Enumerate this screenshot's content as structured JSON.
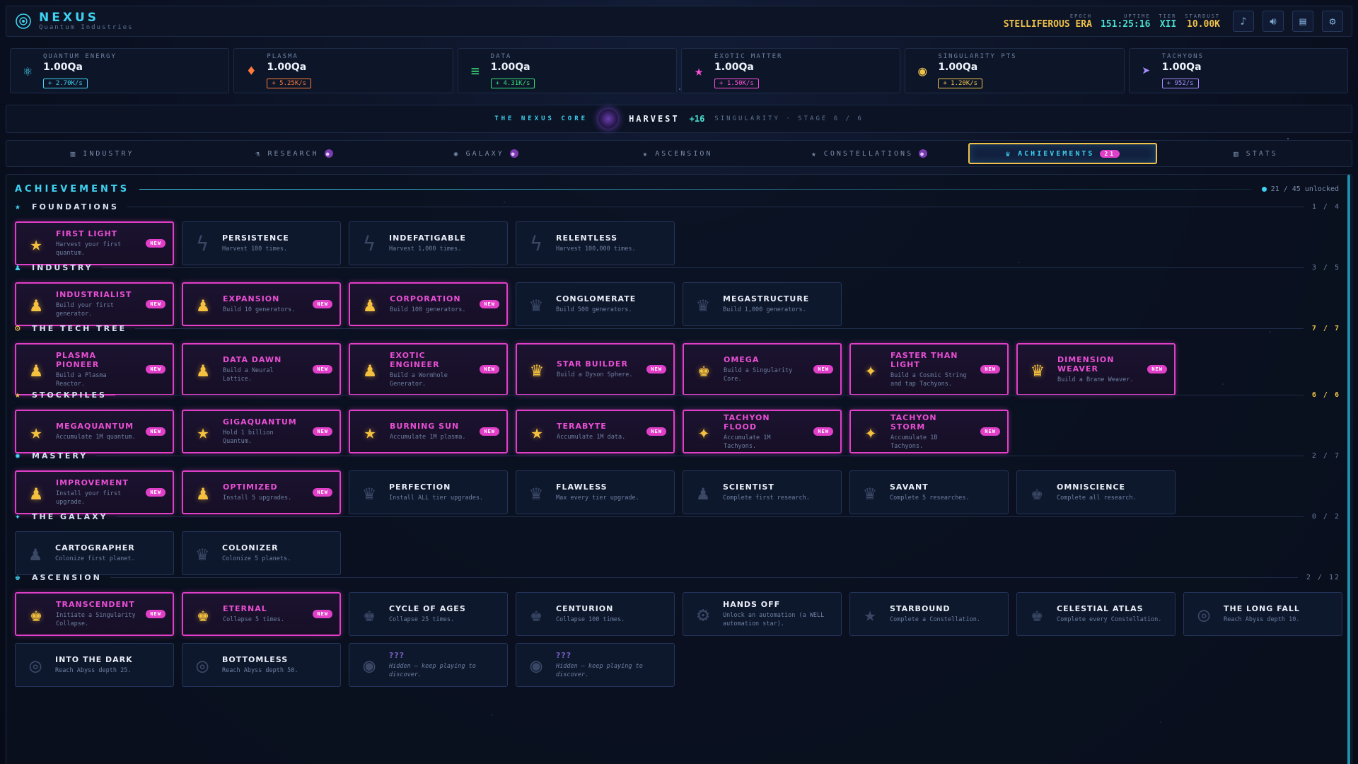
{
  "header": {
    "title": "NEXUS",
    "subtitle": "Quantum Industries",
    "stats": [
      {
        "label": "EPOCH",
        "value": "STELLIFEROUS ERA",
        "color": "#f0c24a"
      },
      {
        "label": "UPTIME",
        "value": "151:25:16",
        "color": "#49e0d1"
      },
      {
        "label": "TIER",
        "value": "XII",
        "color": "#49e0d1"
      },
      {
        "label": "STARDUST",
        "value": "10.00K",
        "color": "#f0c24a"
      }
    ],
    "icons": [
      "music-icon",
      "volume-icon",
      "log-icon",
      "gear-icon"
    ]
  },
  "resources": [
    {
      "label": "QUANTUM ENERGY",
      "value": "1.00Qa",
      "rate": "+ 2.70K/s",
      "color": "#3fd1f0",
      "icon": "atom-icon",
      "glyph": "⚛"
    },
    {
      "label": "PLASMA",
      "value": "1.00Qa",
      "rate": "+ 5.25K/s",
      "color": "#ff7a3a",
      "icon": "flame-icon",
      "glyph": "♦"
    },
    {
      "label": "DATA",
      "value": "1.00Qa",
      "rate": "+ 4.31K/s",
      "color": "#37e07a",
      "icon": "data-bars-icon",
      "glyph": "≡"
    },
    {
      "label": "EXOTIC MATTER",
      "value": "1.00Qa",
      "rate": "+ 1.50K/s",
      "color": "#ff4fd8",
      "icon": "exotic-star-icon",
      "glyph": "★"
    },
    {
      "label": "SINGULARITY PTS",
      "value": "1.00Qa",
      "rate": "+ 1.20K/s",
      "color": "#f0c24a",
      "icon": "singularity-icon",
      "glyph": "◉"
    },
    {
      "label": "TACHYONS",
      "value": "1.00Qa",
      "rate": "+ 952/s",
      "color": "#a98bff",
      "icon": "tachyon-icon",
      "glyph": "➤"
    }
  ],
  "core": {
    "label": "THE NEXUS CORE",
    "action": "HARVEST",
    "gain": "+16",
    "stage": "SINGULARITY · STAGE 6 / 6"
  },
  "tabs": [
    {
      "label": "INDUSTRY",
      "icon": "bar-chart-icon",
      "glyph": "▥",
      "dot": false
    },
    {
      "label": "RESEARCH",
      "icon": "flask-icon",
      "glyph": "⚗",
      "dot": true
    },
    {
      "label": "GALAXY",
      "icon": "galaxy-icon",
      "glyph": "✺",
      "dot": true
    },
    {
      "label": "ASCENSION",
      "icon": "ascension-star-icon",
      "glyph": "★",
      "dot": false
    },
    {
      "label": "CONSTELLATIONS",
      "icon": "constellation-icon",
      "glyph": "★",
      "dot": true
    },
    {
      "label": "ACHIEVEMENTS",
      "icon": "trophy-icon",
      "glyph": "♛",
      "active": true,
      "badge": "21"
    },
    {
      "label": "STATS",
      "icon": "stats-icon",
      "glyph": "▥",
      "dot": false
    }
  ],
  "achievements": {
    "title": "ACHIEVEMENTS",
    "unlocked_text": "21 / 45 unlocked",
    "new_label": "NEW",
    "sections": [
      {
        "title": "FOUNDATIONS",
        "count": "1 / 4",
        "icon": "star-icon",
        "glyph": "★",
        "icon_color": "#3fd1f0",
        "complete": false,
        "items": [
          {
            "name": "FIRST LIGHT",
            "desc": "Harvest your first quantum.",
            "unlocked": true,
            "icon": "star-icon",
            "glyph": "★"
          },
          {
            "name": "PERSISTENCE",
            "desc": "Harvest 100 times.",
            "unlocked": false,
            "icon": "lightning-icon",
            "glyph": "ϟ"
          },
          {
            "name": "INDEFATIGABLE",
            "desc": "Harvest 1,000 times.",
            "unlocked": false,
            "icon": "lightning-icon",
            "glyph": "ϟ"
          },
          {
            "name": "RELENTLESS",
            "desc": "Harvest 100,000 times.",
            "unlocked": false,
            "icon": "lightning-icon",
            "glyph": "ϟ"
          }
        ]
      },
      {
        "title": "INDUSTRY",
        "count": "3 / 5",
        "icon": "medal-icon",
        "glyph": "♟",
        "icon_color": "#3fd1f0",
        "complete": false,
        "items": [
          {
            "name": "INDUSTRIALIST",
            "desc": "Build your first generator.",
            "unlocked": true,
            "icon": "medal-icon",
            "glyph": "♟"
          },
          {
            "name": "EXPANSION",
            "desc": "Build 10 generators.",
            "unlocked": true,
            "icon": "medal-icon",
            "glyph": "♟"
          },
          {
            "name": "CORPORATION",
            "desc": "Build 100 generators.",
            "unlocked": true,
            "icon": "medal-icon",
            "glyph": "♟"
          },
          {
            "name": "CONGLOMERATE",
            "desc": "Build 500 generators.",
            "unlocked": false,
            "icon": "trophy-icon",
            "glyph": "♛"
          },
          {
            "name": "MEGASTRUCTURE",
            "desc": "Build 1,000 generators.",
            "unlocked": false,
            "icon": "trophy-icon",
            "glyph": "♛"
          }
        ]
      },
      {
        "title": "THE TECH TREE",
        "count": "7 / 7",
        "icon": "gear-icon",
        "glyph": "⚙",
        "icon_color": "#f0c24a",
        "complete": true,
        "items": [
          {
            "name": "PLASMA PIONEER",
            "desc": "Build a Plasma Reactor.",
            "unlocked": true,
            "icon": "medal-icon",
            "glyph": "♟"
          },
          {
            "name": "DATA DAWN",
            "desc": "Build a Neural Lattice.",
            "unlocked": true,
            "icon": "medal-icon",
            "glyph": "♟"
          },
          {
            "name": "EXOTIC ENGINEER",
            "desc": "Build a Wormhole Generator.",
            "unlocked": true,
            "icon": "medal-icon",
            "glyph": "♟"
          },
          {
            "name": "STAR BUILDER",
            "desc": "Build a Dyson Sphere.",
            "unlocked": true,
            "icon": "trophy-icon",
            "glyph": "♛"
          },
          {
            "name": "OMEGA",
            "desc": "Build a Singularity Core.",
            "unlocked": true,
            "icon": "crown-icon",
            "glyph": "♚"
          },
          {
            "name": "FASTER THAN LIGHT",
            "desc": "Build a Cosmic String and tap Tachyons.",
            "unlocked": true,
            "icon": "sparkle-icon",
            "glyph": "✦",
            "tall": true
          },
          {
            "name": "DIMENSION WEAVER",
            "desc": "Build a Brane Weaver.",
            "unlocked": true,
            "icon": "trophy-icon",
            "glyph": "♛"
          }
        ]
      },
      {
        "title": "STOCKPILES",
        "count": "6 / 6",
        "icon": "star-icon",
        "glyph": "★",
        "icon_color": "#f0c24a",
        "complete": true,
        "items": [
          {
            "name": "MEGAQUANTUM",
            "desc": "Accumulate 1M quantum.",
            "unlocked": true,
            "icon": "star-icon",
            "glyph": "★"
          },
          {
            "name": "GIGAQUANTUM",
            "desc": "Hold 1 billion Quantum.",
            "unlocked": true,
            "icon": "star-icon",
            "glyph": "★"
          },
          {
            "name": "BURNING SUN",
            "desc": "Accumulate 1M plasma.",
            "unlocked": true,
            "icon": "star-icon",
            "glyph": "★"
          },
          {
            "name": "TERABYTE",
            "desc": "Accumulate 1M data.",
            "unlocked": true,
            "icon": "star-icon",
            "glyph": "★"
          },
          {
            "name": "TACHYON FLOOD",
            "desc": "Accumulate 1M Tachyons.",
            "unlocked": true,
            "icon": "sparkle-icon",
            "glyph": "✦"
          },
          {
            "name": "TACHYON STORM",
            "desc": "Accumulate 1B Tachyons.",
            "unlocked": true,
            "icon": "sparkle-icon",
            "glyph": "✦"
          }
        ]
      },
      {
        "title": "MASTERY",
        "count": "2 / 7",
        "icon": "gear-icon",
        "glyph": "✹",
        "icon_color": "#3fd1f0",
        "complete": false,
        "items": [
          {
            "name": "IMPROVEMENT",
            "desc": "Install your first upgrade.",
            "unlocked": true,
            "icon": "medal-icon",
            "glyph": "♟"
          },
          {
            "name": "OPTIMIZED",
            "desc": "Install 5 upgrades.",
            "unlocked": true,
            "icon": "medal-icon",
            "glyph": "♟"
          },
          {
            "name": "PERFECTION",
            "desc": "Install ALL tier upgrades.",
            "unlocked": false,
            "icon": "trophy-icon",
            "glyph": "♛"
          },
          {
            "name": "FLAWLESS",
            "desc": "Max every tier upgrade.",
            "unlocked": false,
            "icon": "trophy-icon",
            "glyph": "♛"
          },
          {
            "name": "SCIENTIST",
            "desc": "Complete first research.",
            "unlocked": false,
            "icon": "medal-icon",
            "glyph": "♟"
          },
          {
            "name": "SAVANT",
            "desc": "Complete 5 researches.",
            "unlocked": false,
            "icon": "trophy-icon",
            "glyph": "♛"
          },
          {
            "name": "OMNISCIENCE",
            "desc": "Complete all research.",
            "unlocked": false,
            "icon": "crown-icon",
            "glyph": "♚"
          }
        ]
      },
      {
        "title": "THE GALAXY",
        "count": "0 / 2",
        "icon": "sparkle-icon",
        "glyph": "✦",
        "icon_color": "#3fd1f0",
        "complete": false,
        "items": [
          {
            "name": "CARTOGRAPHER",
            "desc": "Colonize first planet.",
            "unlocked": false,
            "icon": "medal-icon",
            "glyph": "♟"
          },
          {
            "name": "COLONIZER",
            "desc": "Colonize 5 planets.",
            "unlocked": false,
            "icon": "trophy-icon",
            "glyph": "♛"
          }
        ]
      },
      {
        "title": "ASCENSION",
        "count": "2 / 12",
        "icon": "crown-icon",
        "glyph": "♚",
        "icon_color": "#3fd1f0",
        "complete": false,
        "items": [
          {
            "name": "TRANSCENDENT",
            "desc": "Initiate a Singularity Collapse.",
            "unlocked": true,
            "icon": "crown-icon",
            "glyph": "♚"
          },
          {
            "name": "ETERNAL",
            "desc": "Collapse 5 times.",
            "unlocked": true,
            "icon": "crown-icon",
            "glyph": "♚"
          },
          {
            "name": "CYCLE OF AGES",
            "desc": "Collapse 25 times.",
            "unlocked": false,
            "icon": "crown-icon",
            "glyph": "♚"
          },
          {
            "name": "CENTURION",
            "desc": "Collapse 100 times.",
            "unlocked": false,
            "icon": "crown-icon",
            "glyph": "♚"
          },
          {
            "name": "HANDS OFF",
            "desc": "Unlock an automation (a WELL automation star).",
            "unlocked": false,
            "icon": "cog-icon",
            "glyph": "⚙"
          },
          {
            "name": "STARBOUND",
            "desc": "Complete a Constellation.",
            "unlocked": false,
            "icon": "star-icon",
            "glyph": "★"
          },
          {
            "name": "CELESTIAL ATLAS",
            "desc": "Complete every Constellation.",
            "unlocked": false,
            "icon": "crown-icon",
            "glyph": "♚"
          },
          {
            "name": "THE LONG FALL",
            "desc": "Reach Abyss depth 10.",
            "unlocked": false,
            "icon": "abyss-icon",
            "glyph": "◎"
          },
          {
            "name": "INTO THE DARK",
            "desc": "Reach Abyss depth 25.",
            "unlocked": false,
            "icon": "abyss-icon",
            "glyph": "◎"
          },
          {
            "name": "BOTTOMLESS",
            "desc": "Reach Abyss depth 50.",
            "unlocked": false,
            "icon": "abyss-icon",
            "glyph": "◎"
          },
          {
            "name": "???",
            "desc": "Hidden — keep playing to discover.",
            "unlocked": false,
            "hidden": true,
            "icon": "eye-icon",
            "glyph": "◉"
          },
          {
            "name": "???",
            "desc": "Hidden — keep playing to discover.",
            "unlocked": false,
            "hidden": true,
            "icon": "eye-icon",
            "glyph": "◉"
          }
        ]
      }
    ]
  }
}
